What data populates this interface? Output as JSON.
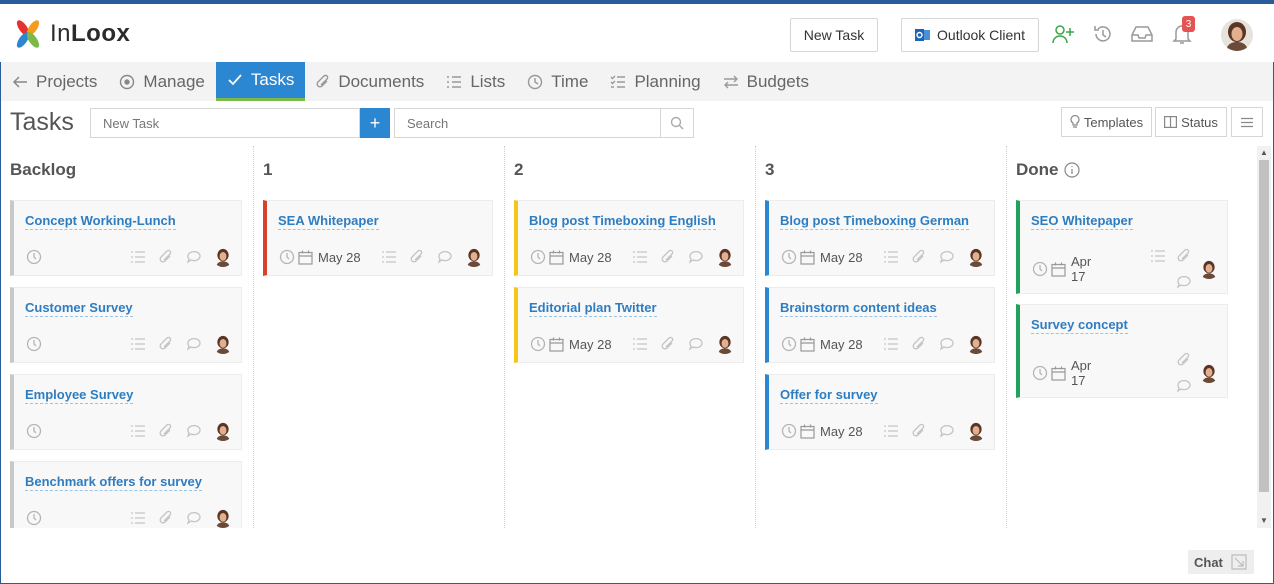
{
  "app": {
    "brand_regular": "In",
    "brand_bold": "Loox"
  },
  "header": {
    "new_task_label": "New Task",
    "outlook_label": "Outlook Client",
    "notification_count": "3"
  },
  "nav": {
    "items": [
      {
        "label": "Projects",
        "icon": "arrow-left-icon"
      },
      {
        "label": "Manage",
        "icon": "target-icon"
      },
      {
        "label": "Tasks",
        "icon": "check-icon",
        "active": true
      },
      {
        "label": "Documents",
        "icon": "paperclip-icon"
      },
      {
        "label": "Lists",
        "icon": "list-icon"
      },
      {
        "label": "Time",
        "icon": "clock-icon"
      },
      {
        "label": "Planning",
        "icon": "checklist-icon"
      },
      {
        "label": "Budgets",
        "icon": "transfer-icon"
      }
    ]
  },
  "toolbar": {
    "title": "Tasks",
    "new_task_placeholder": "New Task",
    "search_placeholder": "Search",
    "templates_label": "Templates",
    "status_label": "Status"
  },
  "columns": [
    {
      "title": "Backlog",
      "cards": [
        {
          "title": "Concept Working-Lunch",
          "date": ""
        },
        {
          "title": "Customer Survey",
          "date": ""
        },
        {
          "title": "Employee Survey",
          "date": ""
        },
        {
          "title": "Benchmark offers for survey",
          "date": ""
        }
      ]
    },
    {
      "title": "1",
      "cards": [
        {
          "title": "SEA Whitepaper",
          "date": "May 28"
        }
      ]
    },
    {
      "title": "2",
      "cards": [
        {
          "title": "Blog post Timeboxing English",
          "date": "May 28"
        },
        {
          "title": "Editorial plan Twitter",
          "date": "May 28"
        }
      ]
    },
    {
      "title": "3",
      "cards": [
        {
          "title": "Blog post Timeboxing German",
          "date": "May 28"
        },
        {
          "title": "Brainstorm content ideas",
          "date": "May 28"
        },
        {
          "title": "Offer for survey",
          "date": "May 28"
        }
      ]
    },
    {
      "title": "Done",
      "cards": [
        {
          "title": "SEO Whitepaper",
          "date_line1": "Apr",
          "date_line2": "17"
        },
        {
          "title": "Survey concept",
          "date_line1": "Apr",
          "date_line2": "17"
        }
      ]
    }
  ],
  "colors": {
    "accent_blue": "#2b87d1",
    "active_underline": "#7ab94a",
    "backlog_border": "#c8c8c8",
    "col1_border": "#d9412d",
    "col2_border": "#f5c518",
    "col3_border": "#2b87d1",
    "done_border": "#1fa35c"
  },
  "footer": {
    "chat_label": "Chat"
  }
}
